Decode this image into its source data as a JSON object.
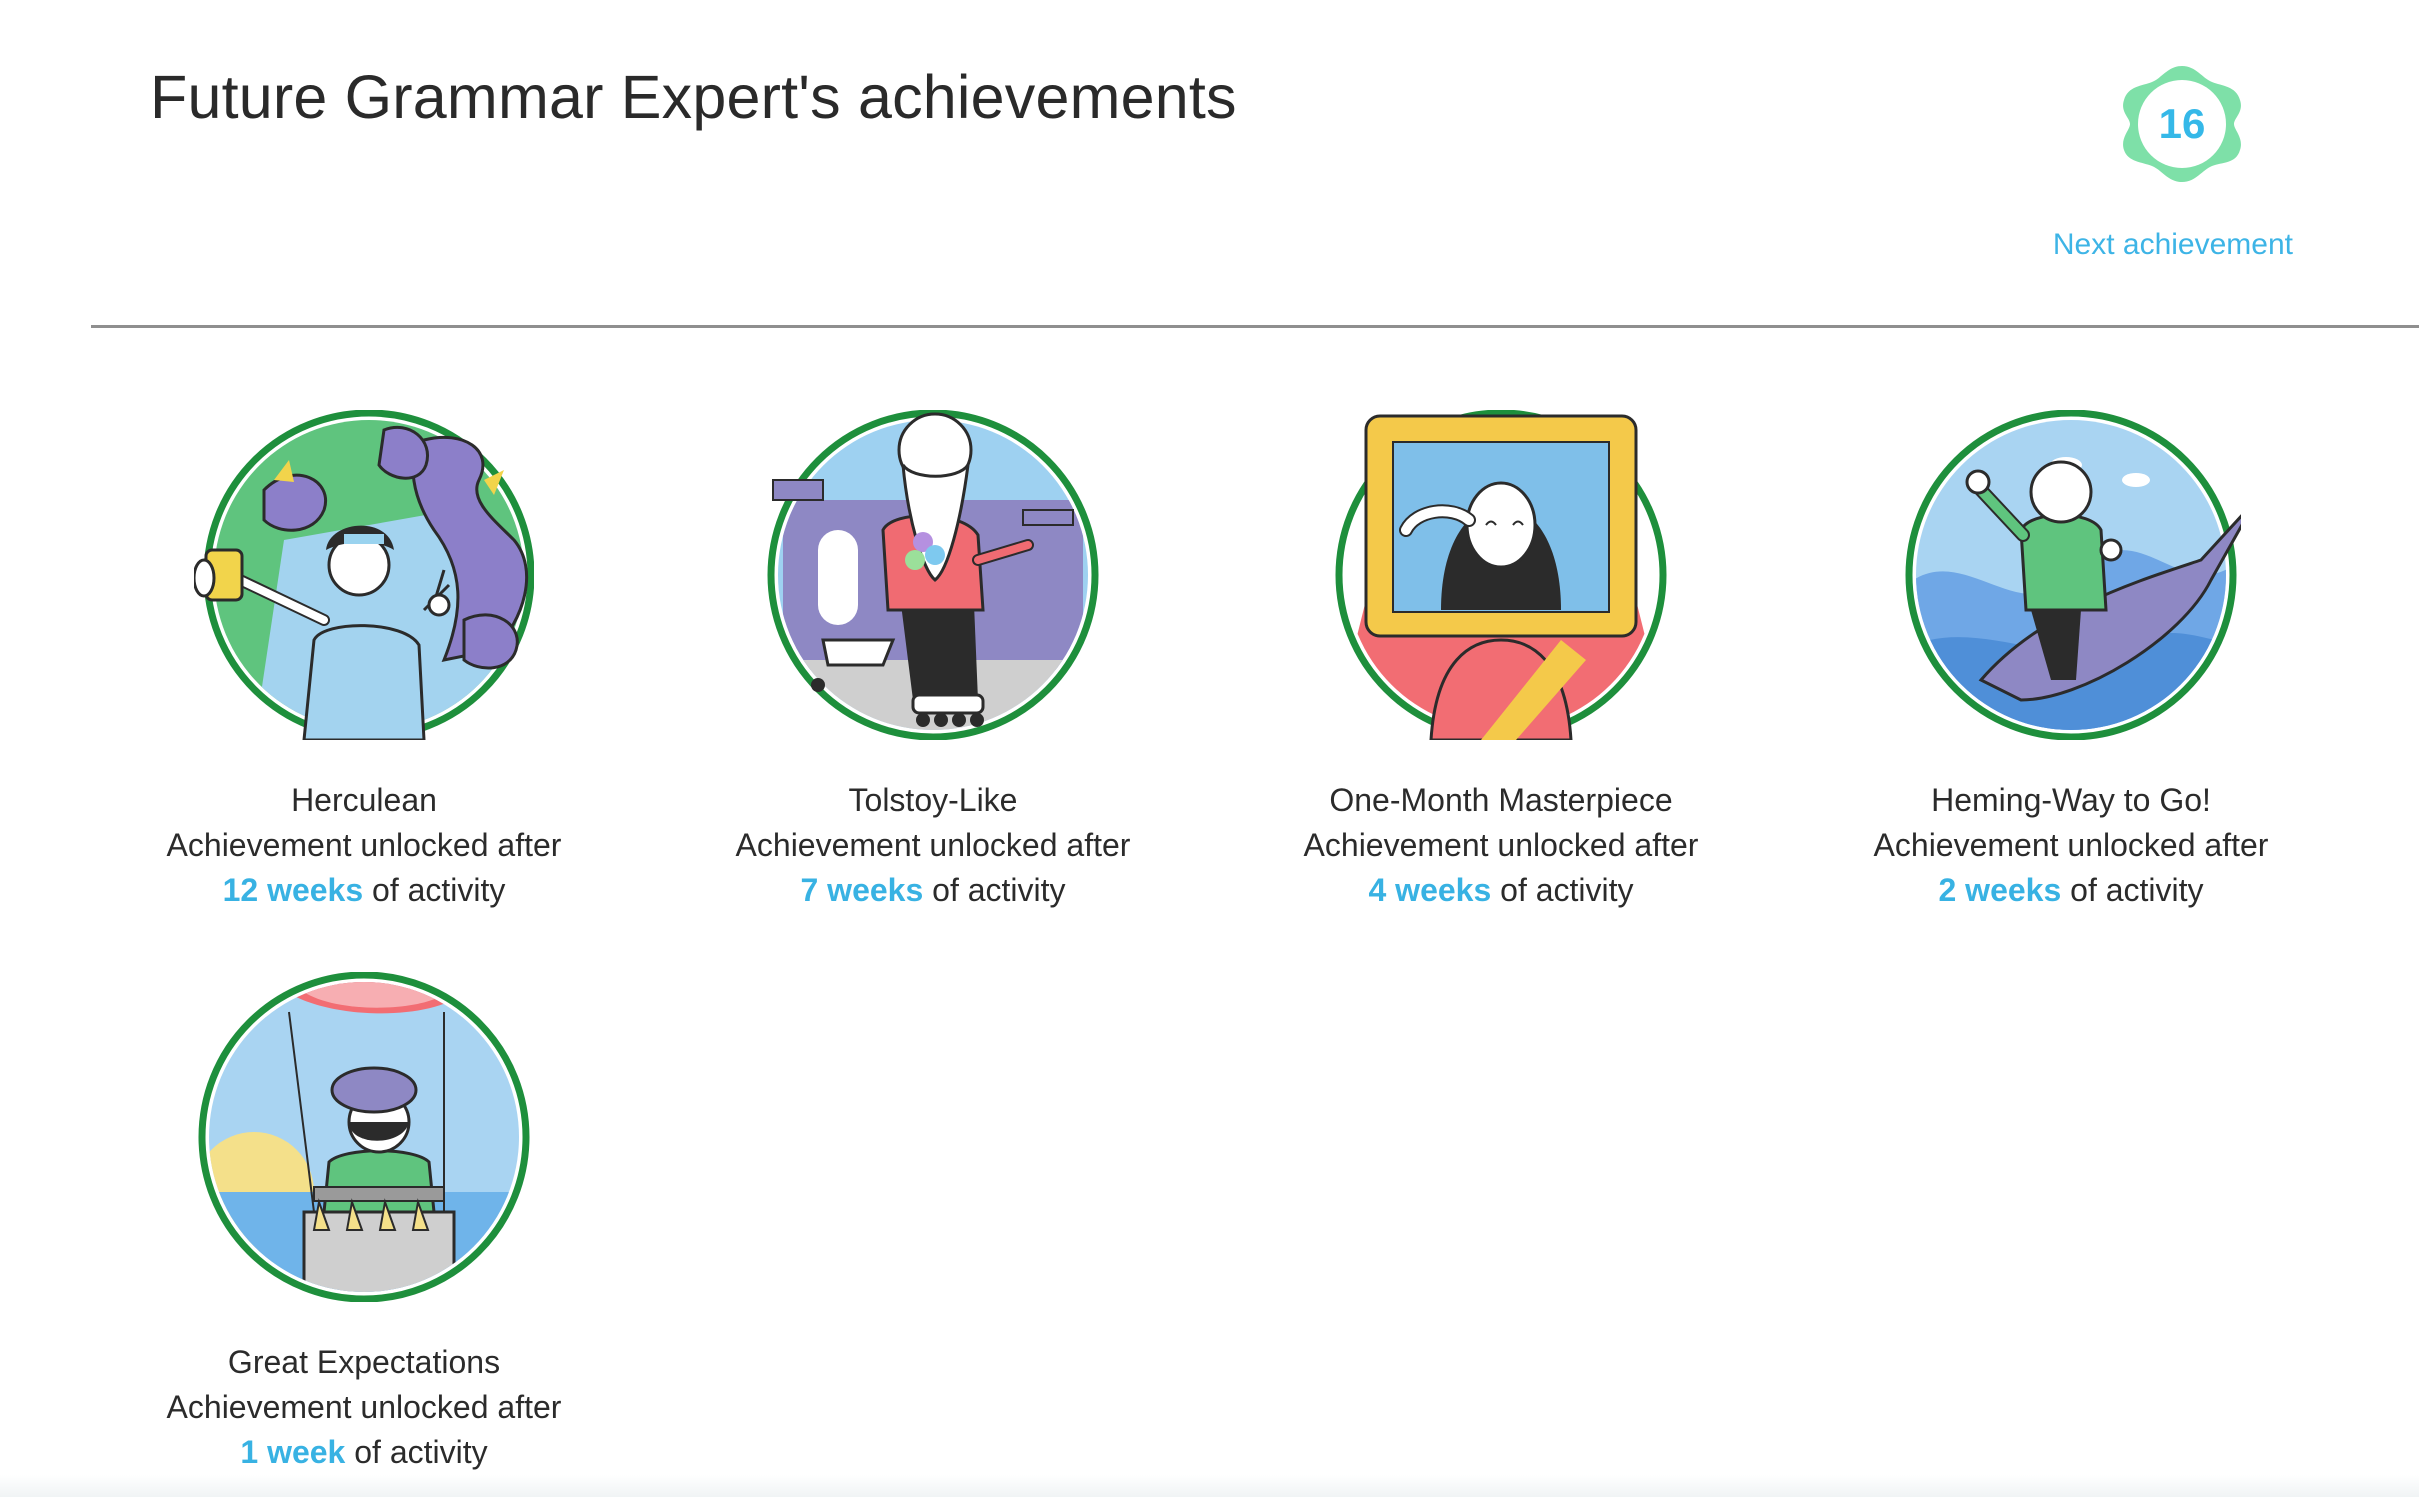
{
  "page": {
    "title": "Future Grammar Expert's achievements"
  },
  "next": {
    "count": "16",
    "link_label": "Next achievement"
  },
  "achievements": [
    {
      "name": "Herculean",
      "unlock_text": "Achievement unlocked after",
      "duration": "12 weeks",
      "suffix": " of activity"
    },
    {
      "name": "Tolstoy-Like",
      "unlock_text": "Achievement unlocked after",
      "duration": "7 weeks",
      "suffix": " of activity"
    },
    {
      "name": "One-Month Masterpiece",
      "unlock_text": "Achievement unlocked after",
      "duration": "4 weeks",
      "suffix": " of activity"
    },
    {
      "name": "Heming-Way to Go!",
      "unlock_text": "Achievement unlocked after",
      "duration": "2 weeks",
      "suffix": " of activity"
    },
    {
      "name": "Great Expectations",
      "unlock_text": "Achievement unlocked after",
      "duration": "1 week",
      "suffix": " of activity"
    }
  ],
  "colors": {
    "accent": "#38b2e3",
    "badge_ring": "#1e8f3c",
    "next_badge": "#7ee0a8"
  },
  "icons": [
    "hydra-selfie-illustration",
    "tolstoy-rollerskates-illustration",
    "mona-lisa-frame-illustration",
    "hemingway-marlin-illustration",
    "hot-air-balloon-illustration"
  ]
}
